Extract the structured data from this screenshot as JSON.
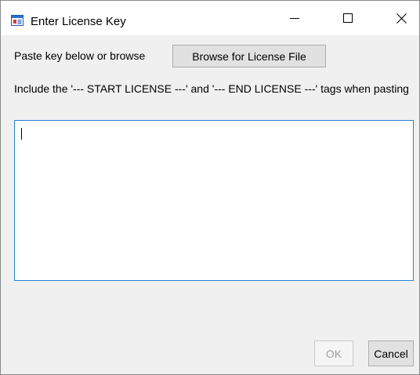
{
  "window": {
    "title": "Enter License Key",
    "app_icon": "form-window-icon"
  },
  "caption_buttons": {
    "minimize": "minimize-icon",
    "maximize": "maximize-icon",
    "close": "close-icon"
  },
  "content": {
    "paste_label": "Paste key below or browse",
    "browse_button": "Browse for License File",
    "instructions": "Include the '--- START LICENSE ---' and '--- END LICENSE ---' tags when pasting",
    "license_key_value": ""
  },
  "footer": {
    "ok_label": "OK",
    "ok_enabled": false,
    "cancel_label": "Cancel"
  },
  "colors": {
    "focus_border": "#2a7fd4",
    "dialog_background": "#f0f0f0",
    "button_face": "#e1e1e1",
    "disabled_text": "#a0a0a0"
  }
}
